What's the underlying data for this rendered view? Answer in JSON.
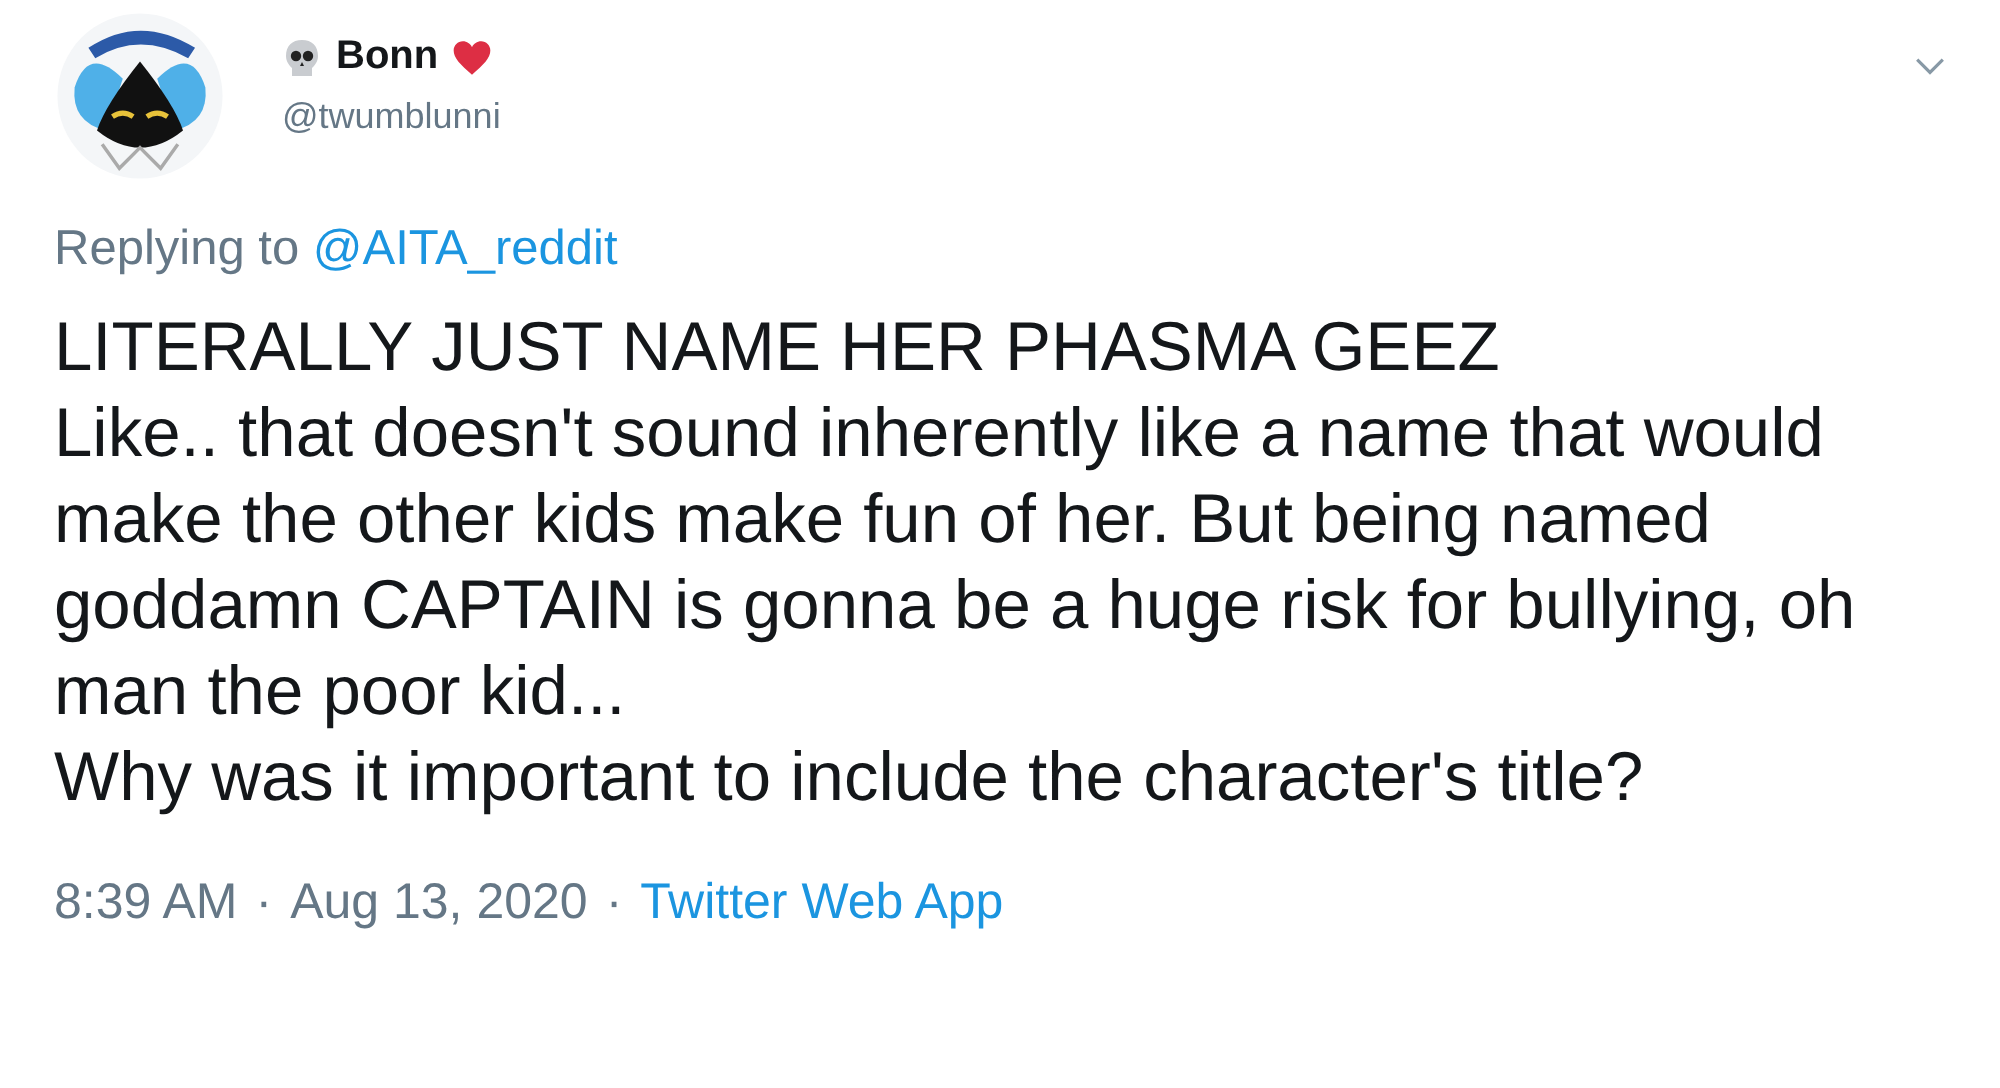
{
  "author": {
    "name": "Bonn",
    "handle": "@twumblunni"
  },
  "reply_to": {
    "label": "Replying to",
    "handle": "@AITA_reddit"
  },
  "body": [
    "LITERALLY JUST NAME HER PHASMA GEEZ",
    "Like.. that doesn't sound inherently like a name that would make the other kids make fun of her. But being named goddamn CAPTAIN is gonna be a huge risk for bullying, oh man the poor kid...",
    "Why was it important to include the character's title?"
  ],
  "footer": {
    "time": "8:39 AM",
    "separator": "·",
    "date": "Aug 13, 2020",
    "source": "Twitter Web App"
  }
}
